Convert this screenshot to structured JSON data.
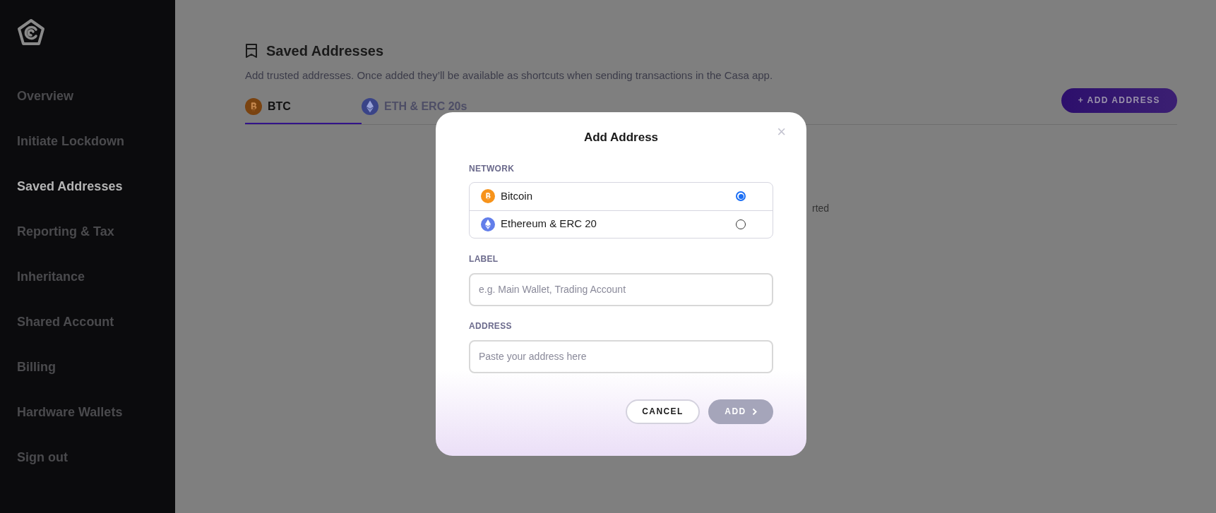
{
  "sidebar": {
    "items": [
      {
        "label": "Overview",
        "selected": false
      },
      {
        "label": "Initiate Lockdown",
        "selected": false
      },
      {
        "label": "Saved Addresses",
        "selected": true
      },
      {
        "label": "Reporting & Tax",
        "selected": false
      },
      {
        "label": "Inheritance",
        "selected": false
      },
      {
        "label": "Shared Account",
        "selected": false
      },
      {
        "label": "Billing",
        "selected": false
      },
      {
        "label": "Hardware Wallets",
        "selected": false
      },
      {
        "label": "Sign out",
        "selected": false
      }
    ]
  },
  "page": {
    "title": "Saved Addresses",
    "subtitle": "Add trusted addresses. Once added they’ll be available as shortcuts when sending transactions in the Casa app.",
    "tabs": [
      {
        "label": "BTC",
        "kind": "btc",
        "selected": true
      },
      {
        "label": "ETH & ERC 20s",
        "kind": "eth",
        "selected": false
      }
    ],
    "add_button": "+ ADD ADDRESS",
    "hidden_text": "rted"
  },
  "modal": {
    "title": "Add Address",
    "close": "×",
    "network_label": "NETWORK",
    "networks": [
      {
        "label": "Bitcoin",
        "kind": "btc",
        "selected": true
      },
      {
        "label": "Ethereum & ERC 20",
        "kind": "eth",
        "selected": false
      }
    ],
    "label_field": {
      "label": "LABEL",
      "placeholder": "e.g. Main Wallet, Trading Account"
    },
    "address_field": {
      "label": "ADDRESS",
      "placeholder": "Paste your address here"
    },
    "cancel": "CANCEL",
    "add": {
      "label": "ADD",
      "disabled": true
    }
  }
}
